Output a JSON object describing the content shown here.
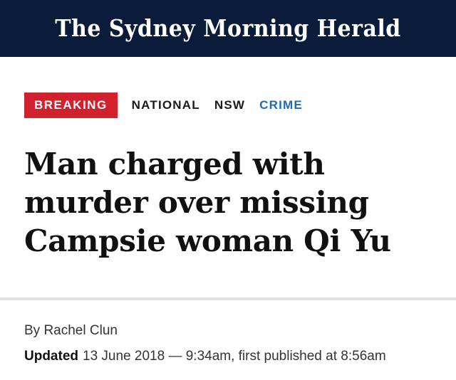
{
  "masthead": {
    "title": "The Sydney Morning Herald"
  },
  "tags": {
    "breaking": "BREAKING",
    "items": [
      "NATIONAL",
      "NSW",
      "CRIME"
    ]
  },
  "headline": "Man charged with murder over missing Campsie woman Qi Yu",
  "byline": "By Rachel Clun",
  "dateline": {
    "label": "Updated",
    "text": "13 June 2018 — 9:34am, first published at 8:56am"
  },
  "colors": {
    "masthead_bg": "#0a1c3a",
    "breaking_bg": "#d1202e",
    "crime_link": "#1c6bb0"
  }
}
